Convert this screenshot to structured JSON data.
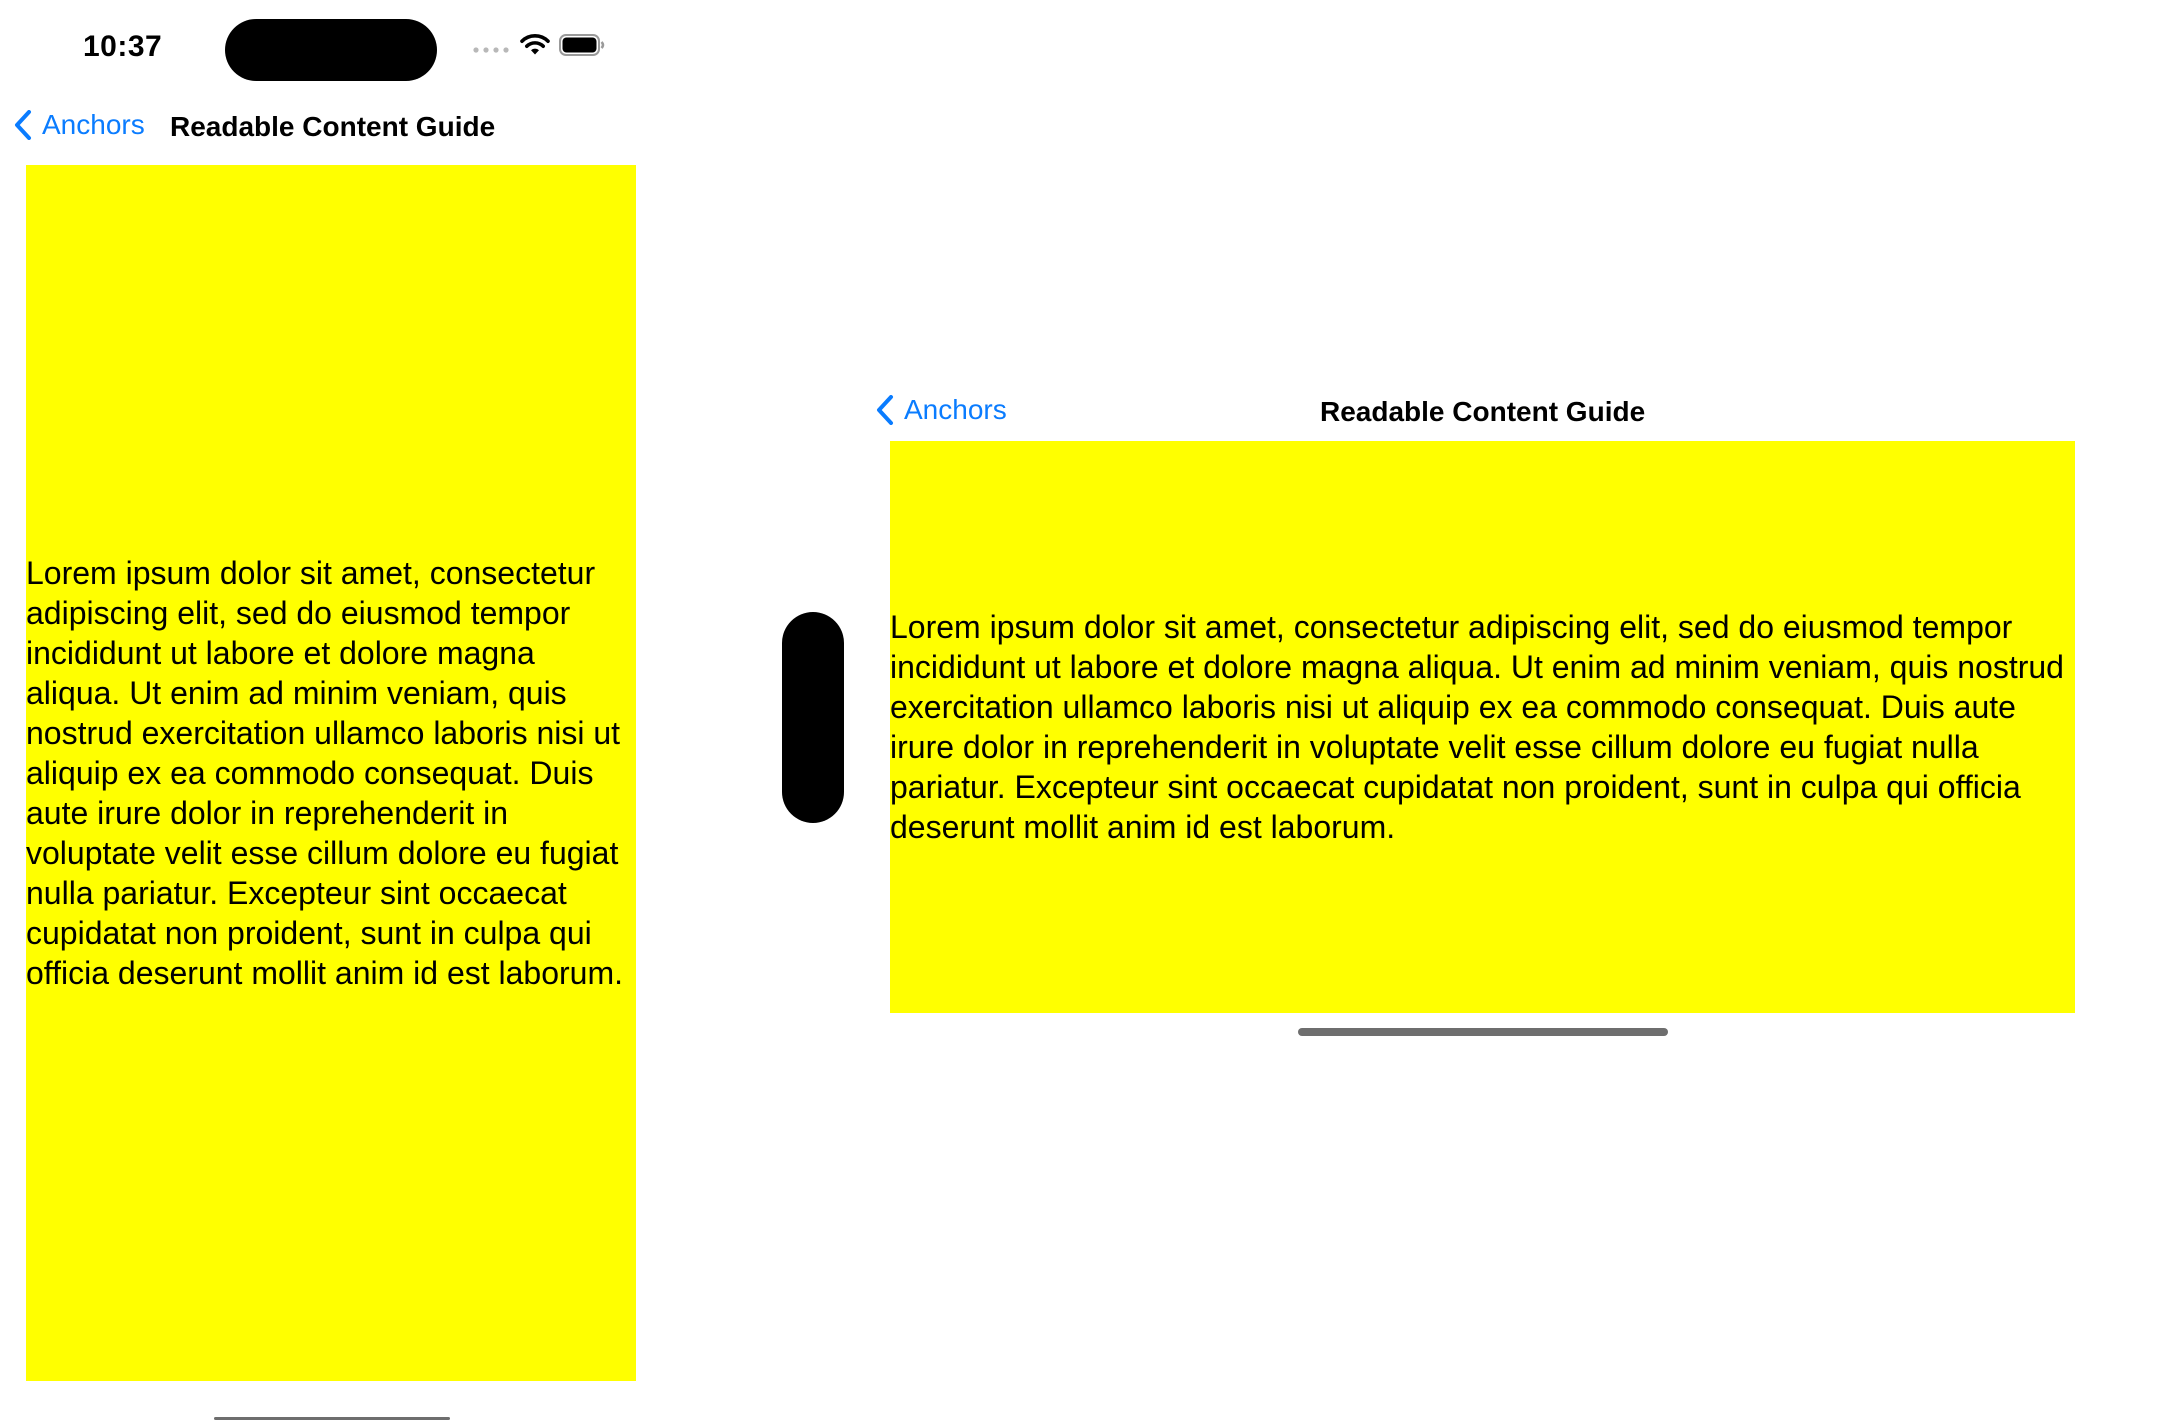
{
  "portrait": {
    "status_bar": {
      "time": "10:37",
      "icons": [
        "signal-dots-icon",
        "wifi-icon",
        "battery-icon"
      ]
    },
    "nav_bar": {
      "back_label": "Anchors",
      "title": "Readable Content Guide"
    },
    "content": {
      "background": "#ffff00",
      "text": "Lorem ipsum dolor sit amet, consectetur adipiscing elit, sed do eiusmod tempor incididunt ut labore et dolore magna aliqua. Ut enim ad minim veniam, quis nostrud exercitation ullamco laboris nisi ut aliquip ex ea commodo consequat. Duis aute irure dolor in reprehenderit in voluptate velit esse cillum dolore eu fugiat nulla pariatur. Excepteur sint occaecat cupidatat non proident, sunt in culpa qui officia deserunt mollit anim id est laborum."
    }
  },
  "landscape": {
    "nav_bar": {
      "back_label": "Anchors",
      "title": "Readable Content Guide"
    },
    "content": {
      "background": "#ffff00",
      "text": "Lorem ipsum dolor sit amet, consectetur adipiscing elit, sed do eiusmod tempor incididunt ut labore et dolore magna aliqua. Ut enim ad minim veniam, quis nostrud exercitation ullamco laboris nisi ut aliquip ex ea commodo consequat. Duis aute irure dolor in reprehenderit in voluptate velit esse cillum dolore eu fugiat nulla pariatur. Excepteur sint occaecat cupidatat non proident, sunt in culpa qui officia deserunt mollit anim id est laborum."
    }
  },
  "colors": {
    "accent": "#0a7cff",
    "content_background": "#ffff00",
    "text": "#000000"
  }
}
